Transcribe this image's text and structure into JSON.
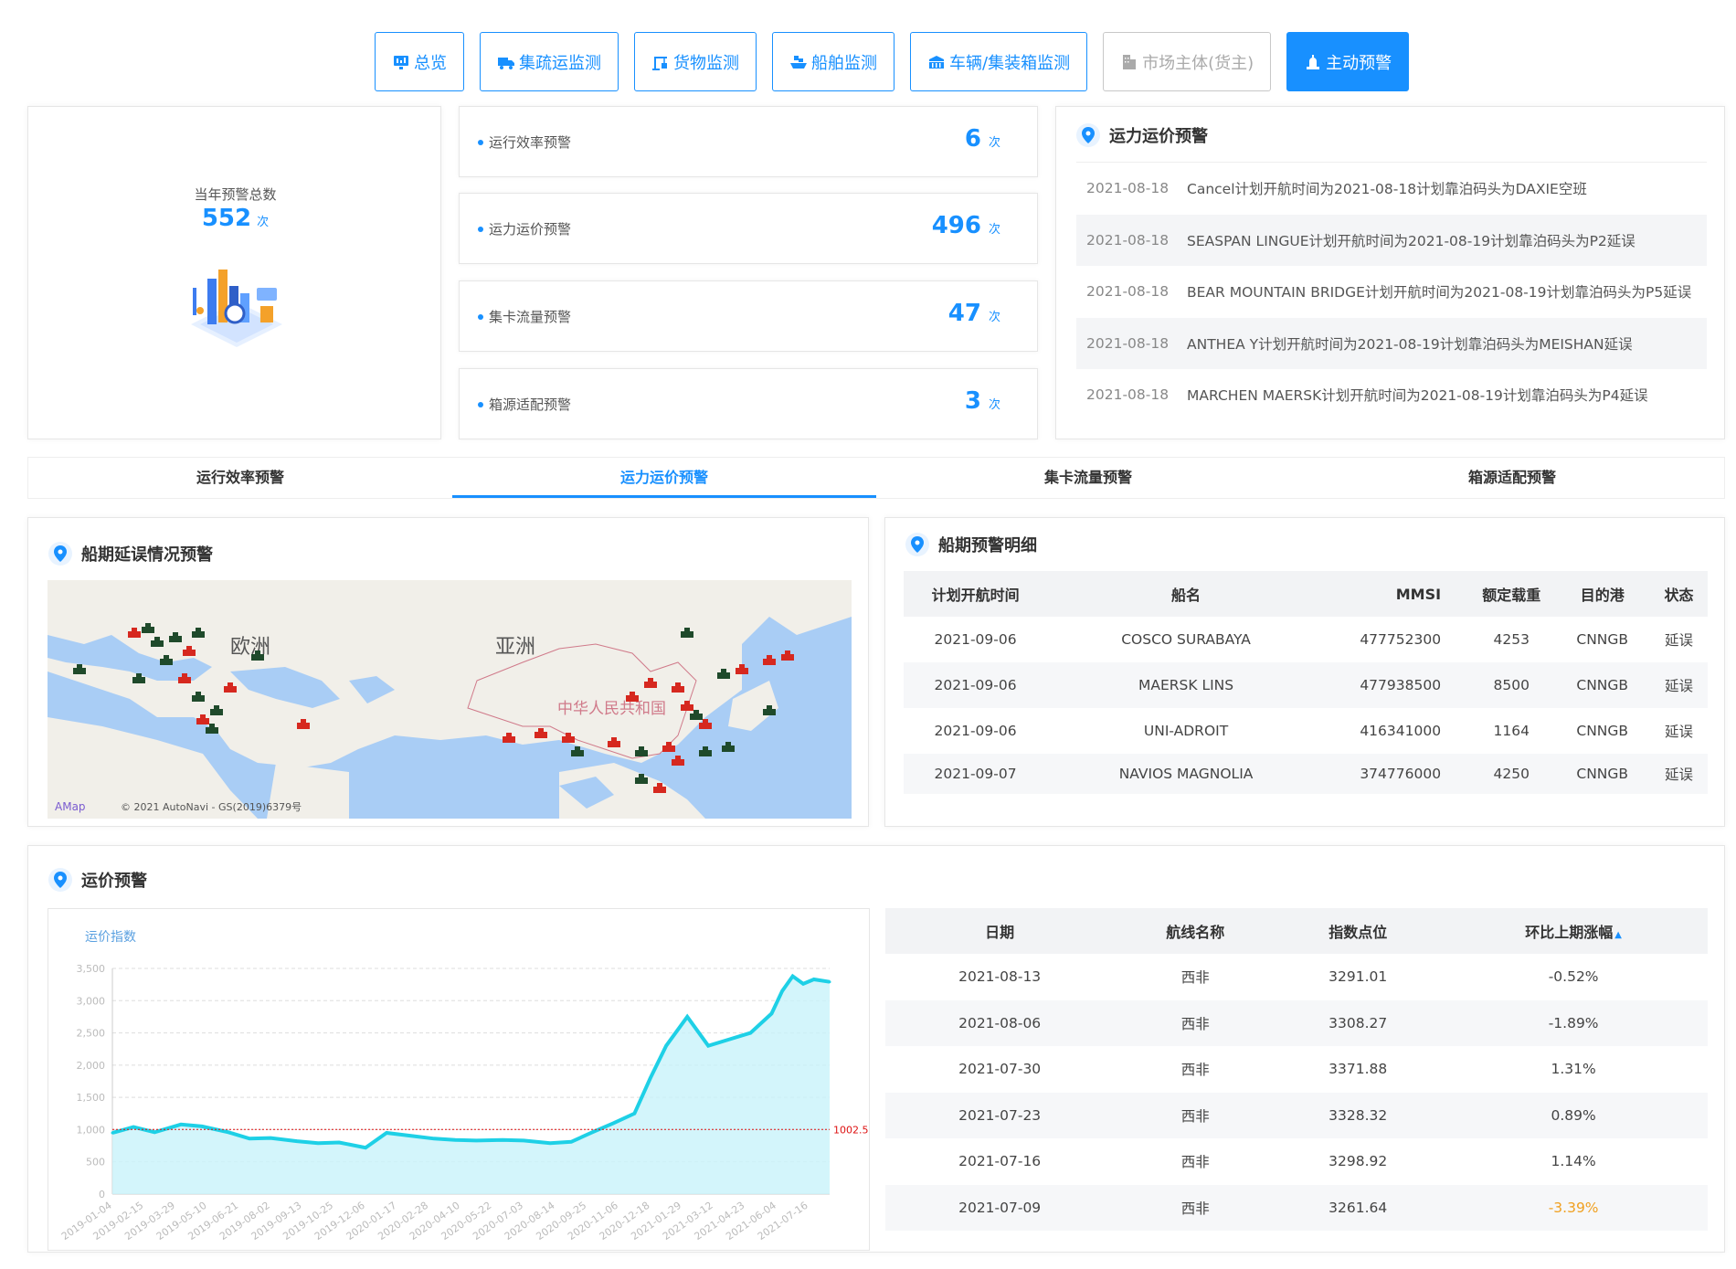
{
  "nav": [
    {
      "label": "总览",
      "icon": "monitor-icon",
      "state": "normal"
    },
    {
      "label": "集疏运监测",
      "icon": "truck-icon",
      "state": "normal"
    },
    {
      "label": "货物监测",
      "icon": "crane-icon",
      "state": "normal"
    },
    {
      "label": "船舶监测",
      "icon": "ship-icon",
      "state": "normal"
    },
    {
      "label": "车辆/集装箱监测",
      "icon": "container-icon",
      "state": "normal"
    },
    {
      "label": "市场主体(货主)",
      "icon": "building-icon",
      "state": "disabled"
    },
    {
      "label": "主动预警",
      "icon": "warning-icon",
      "state": "active"
    }
  ],
  "total": {
    "label": "当年预警总数",
    "value": "552",
    "unit": "次"
  },
  "counts": [
    {
      "label": "运行效率预警",
      "value": "6",
      "unit": "次"
    },
    {
      "label": "运力运价预警",
      "value": "496",
      "unit": "次"
    },
    {
      "label": "集卡流量预警",
      "value": "47",
      "unit": "次"
    },
    {
      "label": "箱源适配预警",
      "value": "3",
      "unit": "次"
    }
  ],
  "alerts": {
    "title": "运力运价预警",
    "items": [
      {
        "date": "2021-08-18",
        "text": "Cancel计划开航时间为2021-08-18计划靠泊码头为DAXIE空班"
      },
      {
        "date": "2021-08-18",
        "text": "SEASPAN LINGUE计划开航时间为2021-08-19计划靠泊码头为P2延误"
      },
      {
        "date": "2021-08-18",
        "text": "BEAR MOUNTAIN BRIDGE计划开航时间为2021-08-19计划靠泊码头为P5延误"
      },
      {
        "date": "2021-08-18",
        "text": "ANTHEA Y计划开航时间为2021-08-19计划靠泊码头为MEISHAN延误"
      },
      {
        "date": "2021-08-18",
        "text": "MARCHEN MAERSK计划开航时间为2021-08-19计划靠泊码头为P4延误"
      }
    ]
  },
  "tabs": [
    {
      "label": "运行效率预警",
      "active": false
    },
    {
      "label": "运力运价预警",
      "active": true
    },
    {
      "label": "集卡流量预警",
      "active": false
    },
    {
      "label": "箱源适配预警",
      "active": false
    }
  ],
  "map": {
    "title": "船期延误情况预警",
    "labels": {
      "europe": "欧洲",
      "asia": "亚洲",
      "china": "中华人民共和国"
    },
    "copyright": "© 2021 AutoNavi - GS(2019)6379号",
    "logo": "AMap"
  },
  "ships": {
    "title": "船期预警明细",
    "columns": [
      "计划开航时间",
      "船名",
      "MMSI",
      "额定载重",
      "目的港",
      "状态"
    ],
    "rows": [
      [
        "2021-09-06",
        "COSCO SURABAYA",
        "477752300",
        "4253",
        "CNNGB",
        "延误"
      ],
      [
        "2021-09-06",
        "MAERSK LINS",
        "477938500",
        "8500",
        "CNNGB",
        "延误"
      ],
      [
        "2021-09-06",
        "UNI-ADROIT",
        "416341000",
        "1164",
        "CNNGB",
        "延误"
      ],
      [
        "2021-09-07",
        "NAVIOS MAGNOLIA",
        "374776000",
        "4250",
        "CNNGB",
        "延误"
      ]
    ]
  },
  "freight": {
    "title": "运价预警",
    "columns": [
      "日期",
      "航线名称",
      "指数点位",
      "环比上期涨幅"
    ],
    "rows": [
      [
        "2021-08-13",
        "西非",
        "3291.01",
        "-0.52%"
      ],
      [
        "2021-08-06",
        "西非",
        "3308.27",
        "-1.89%"
      ],
      [
        "2021-07-30",
        "西非",
        "3371.88",
        "1.31%"
      ],
      [
        "2021-07-23",
        "西非",
        "3328.32",
        "0.89%"
      ],
      [
        "2021-07-16",
        "西非",
        "3298.92",
        "1.14%"
      ],
      [
        "2021-07-09",
        "西非",
        "3261.64",
        "-3.39%"
      ]
    ],
    "highlight_row": 5,
    "highlight_color": "#f0a020"
  },
  "chart_data": {
    "type": "area",
    "title": "",
    "ylabel": "运价指数",
    "ylim": [
      0,
      3500
    ],
    "yticks": [
      "0",
      "500",
      "1,000",
      "1,500",
      "2,000",
      "2,500",
      "3,000",
      "3,500"
    ],
    "xticks": [
      "2019-01-04",
      "2019-02-15",
      "2019-03-29",
      "2019-05-10",
      "2019-06-21",
      "2019-08-02",
      "2019-09-13",
      "2019-10-25",
      "2019-12-06",
      "2020-01-17",
      "2020-02-28",
      "2020-04-10",
      "2020-05-22",
      "2020-07-03",
      "2020-08-14",
      "2020-09-25",
      "2020-11-06",
      "2020-12-18",
      "2021-01-29",
      "2021-03-12",
      "2021-04-23",
      "2021-06-04",
      "2021-07-16"
    ],
    "x": [
      "2019-01-04",
      "2019-02-01",
      "2019-03-01",
      "2019-04-05",
      "2019-05-03",
      "2019-06-07",
      "2019-07-05",
      "2019-08-02",
      "2019-09-06",
      "2019-10-04",
      "2019-11-01",
      "2019-12-06",
      "2020-01-03",
      "2020-02-07",
      "2020-03-06",
      "2020-04-03",
      "2020-05-01",
      "2020-06-05",
      "2020-07-03",
      "2020-08-07",
      "2020-09-04",
      "2020-10-02",
      "2020-10-30",
      "2020-11-27",
      "2020-12-18",
      "2021-01-08",
      "2021-02-05",
      "2021-03-05",
      "2021-04-02",
      "2021-04-30",
      "2021-05-28",
      "2021-06-11",
      "2021-06-25",
      "2021-07-09",
      "2021-07-23",
      "2021-08-13"
    ],
    "values": [
      950,
      1040,
      960,
      1080,
      1050,
      960,
      860,
      870,
      820,
      790,
      800,
      720,
      950,
      900,
      860,
      840,
      830,
      840,
      830,
      790,
      810,
      960,
      1100,
      1250,
      1800,
      2300,
      2750,
      2300,
      2400,
      2500,
      2800,
      3150,
      3380,
      3260,
      3330,
      3291
    ],
    "markline": {
      "value": 1002.5,
      "label": "1002.5",
      "color": "#d11"
    },
    "series_color": "#1ed0e6",
    "fill_color": "#c8f3fa",
    "grid": "horizontal-dashed"
  }
}
